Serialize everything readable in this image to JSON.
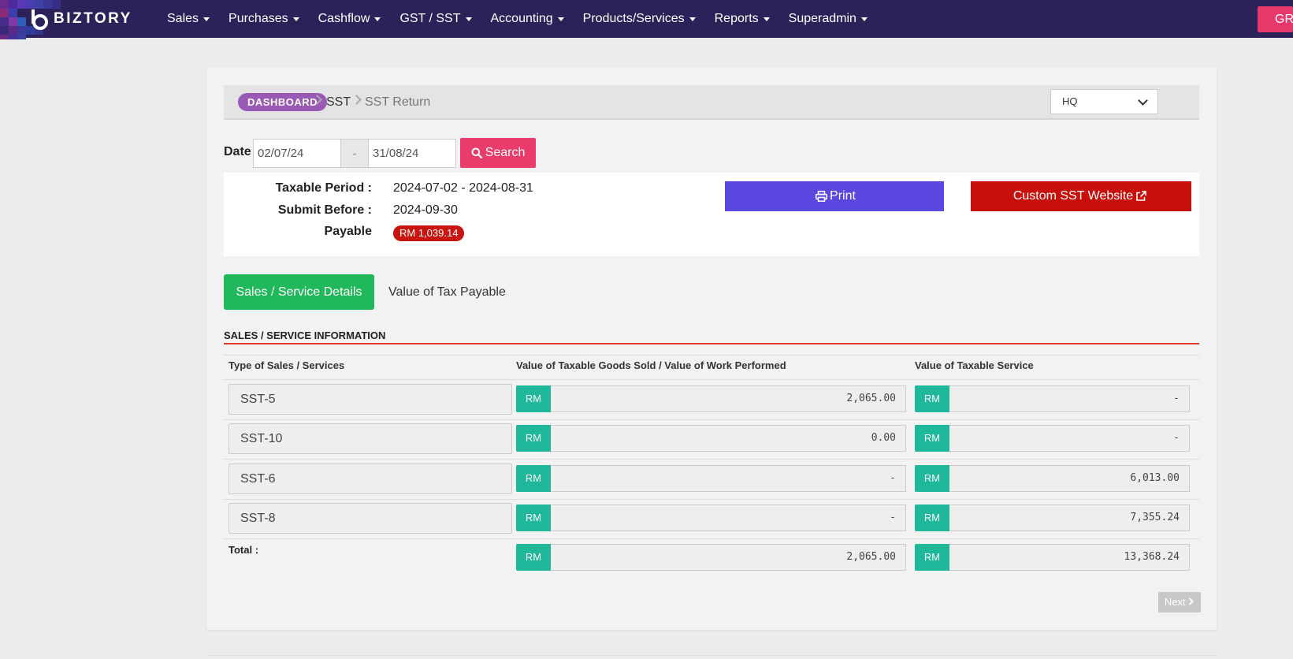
{
  "brand": {
    "name": "BIZTORY"
  },
  "nav": {
    "items": [
      {
        "label": "Sales"
      },
      {
        "label": "Purchases"
      },
      {
        "label": "Cashflow"
      },
      {
        "label": "GST / SST"
      },
      {
        "label": "Accounting"
      },
      {
        "label": "Products/Services"
      },
      {
        "label": "Reports"
      },
      {
        "label": "Superadmin"
      }
    ],
    "right_button": "GR"
  },
  "breadcrumb": {
    "home": "DASHBOARD",
    "level1": "SST",
    "current": "SST Return",
    "branch_selected": "HQ"
  },
  "filter": {
    "date_label": "Date",
    "from": "02/07/24",
    "separator": "-",
    "to": "31/08/24",
    "search_label": "Search"
  },
  "info": {
    "period_label": "Taxable Period :",
    "period_value": "2024-07-02 - 2024-08-31",
    "submit_label": "Submit Before :",
    "submit_value": "2024-09-30",
    "payable_label": "Payable",
    "payable_value": "RM 1,039.14",
    "print_label": "Print",
    "custom_label": "Custom SST Website"
  },
  "tabs": [
    {
      "label": "Sales / Service Details",
      "active": true
    },
    {
      "label": "Value of Tax Payable",
      "active": false
    }
  ],
  "section": {
    "title": "SALES / SERVICE INFORMATION",
    "headers": {
      "type": "Type of Sales / Services",
      "goods": "Value of Taxable Goods Sold / Value of Work Performed",
      "service": "Value of Taxable Service"
    },
    "currency": "RM",
    "rows": [
      {
        "type": "SST-5",
        "goods": "2,065.00",
        "service": "-"
      },
      {
        "type": "SST-10",
        "goods": "0.00",
        "service": "-"
      },
      {
        "type": "SST-6",
        "goods": "-",
        "service": "6,013.00"
      },
      {
        "type": "SST-8",
        "goods": "-",
        "service": "7,355.24"
      }
    ],
    "total": {
      "label": "Total :",
      "goods": "2,065.00",
      "service": "13,368.24"
    }
  },
  "pager": {
    "next_label": "Next"
  },
  "colors": {
    "navbar": "#2c2159",
    "tab_active": "#21b85b",
    "rm_tag": "#1fb89a",
    "print_button": "#5a47e0",
    "custom_button": "#c7100c",
    "search_button": "#ea3c6a",
    "section_rule": "#e03a2a",
    "breadcrumb_pill": "#9b59b6"
  }
}
